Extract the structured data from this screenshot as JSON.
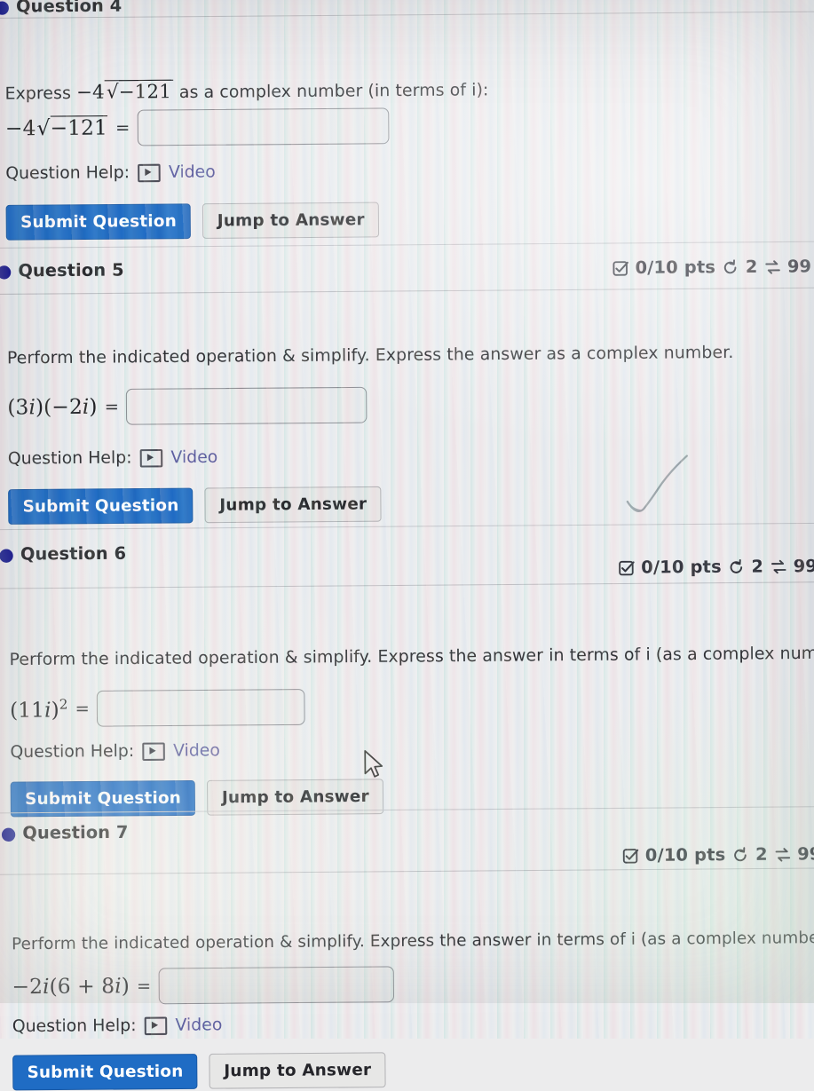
{
  "meta": {
    "help_label": "Question Help:",
    "video_label": "Video",
    "submit_label": "Submit Question",
    "jump_label": "Jump to Answer",
    "pts_label": "0/10 pts",
    "attempts_value": "2",
    "retries_value": "99",
    "icons": {
      "status": "checkbox-check-icon",
      "attempts": "circular-arrow-icon",
      "retries": "swap-arrows-icon",
      "info": "info-circle-icon",
      "video": "video-play-icon",
      "bullet": "question-bullet-icon",
      "cursor": "mouse-cursor-arrow"
    }
  },
  "questions": [
    {
      "title": "Question 4",
      "prompt_parts": {
        "a": "Express",
        "math": "−4√−121",
        "b": "as a complex number (in terms of i):"
      },
      "expression": "−4√−121",
      "equals": "=",
      "answer_value": "",
      "badge_visible": false
    },
    {
      "title": "Question 5",
      "prompt": "Perform the indicated operation & simplify. Express the answer as a complex number.",
      "expression": "(3i)(−2i)",
      "equals": "=",
      "answer_value": "",
      "badge_visible": true
    },
    {
      "title": "Question 6",
      "prompt": "Perform the indicated operation & simplify. Express the answer in terms of i (as a complex number)",
      "expression": "(11i)²",
      "equals": "=",
      "answer_value": "",
      "badge_visible": true
    },
    {
      "title": "Question 7",
      "prompt": "Perform the indicated operation & simplify. Express the answer in terms of i (as a complex number).",
      "expression": "−2i(6 + 8i)",
      "equals": "=",
      "answer_value": "",
      "badge_visible": true
    }
  ],
  "colors": {
    "primary_button": "#1f6cc4",
    "bullet": "#16168e",
    "video_link": "#5a5a9e",
    "page_background": "#ededee"
  }
}
